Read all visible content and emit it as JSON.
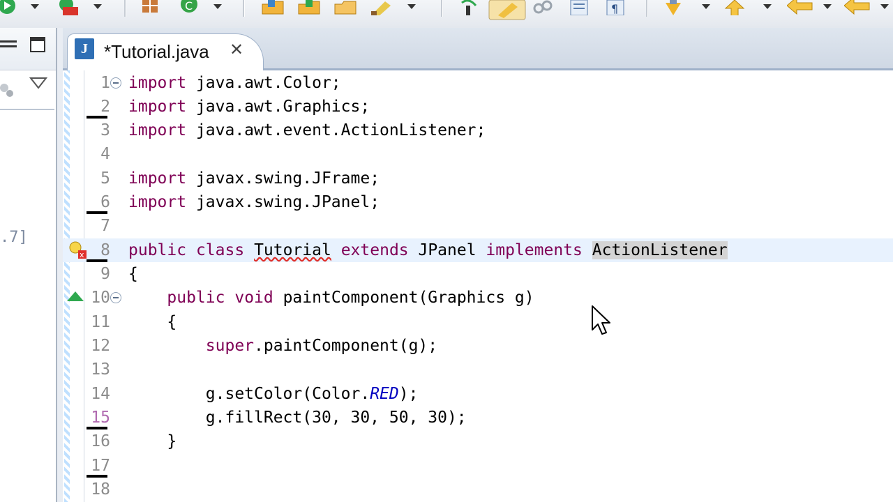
{
  "toolbar": {
    "icons": [
      "run-icon",
      "debug-icon",
      "package-icon",
      "refresh-icon",
      "folder-open-icon",
      "open-type-icon",
      "open-resource-icon",
      "brush-icon",
      "step-icon",
      "highlight-icon",
      "link-icon",
      "outline-icon",
      "paragraph-icon",
      "annotation-icon",
      "up-icon",
      "back-icon",
      "forward-icon"
    ]
  },
  "left_view": {
    "partial_text": ".7]"
  },
  "editor": {
    "tab": {
      "title": "*Tutorial.java",
      "close": "✕",
      "icon_letter": "J"
    },
    "lines": [
      {
        "n": "1",
        "code": "import java.awt.Color;"
      },
      {
        "n": "2",
        "code": "import java.awt.Graphics;"
      },
      {
        "n": "3",
        "code": "import java.awt.event.ActionListener;"
      },
      {
        "n": "4",
        "code": ""
      },
      {
        "n": "5",
        "code": "import javax.swing.JFrame;"
      },
      {
        "n": "6",
        "code": "import javax.swing.JPanel;"
      },
      {
        "n": "7",
        "code": ""
      },
      {
        "n": "8",
        "code": "public class Tutorial extends JPanel implements ActionListener"
      },
      {
        "n": "9",
        "code": "{"
      },
      {
        "n": "10",
        "code": "    public void paintComponent(Graphics g)"
      },
      {
        "n": "11",
        "code": "    {"
      },
      {
        "n": "12",
        "code": "        super.paintComponent(g);"
      },
      {
        "n": "13",
        "code": ""
      },
      {
        "n": "14",
        "code": "        g.setColor(Color.RED);"
      },
      {
        "n": "15",
        "code": "        g.fillRect(30, 30, 50, 30);"
      },
      {
        "n": "16",
        "code": "    }"
      },
      {
        "n": "17",
        "code": ""
      },
      {
        "n": "18",
        "code": ""
      }
    ]
  }
}
